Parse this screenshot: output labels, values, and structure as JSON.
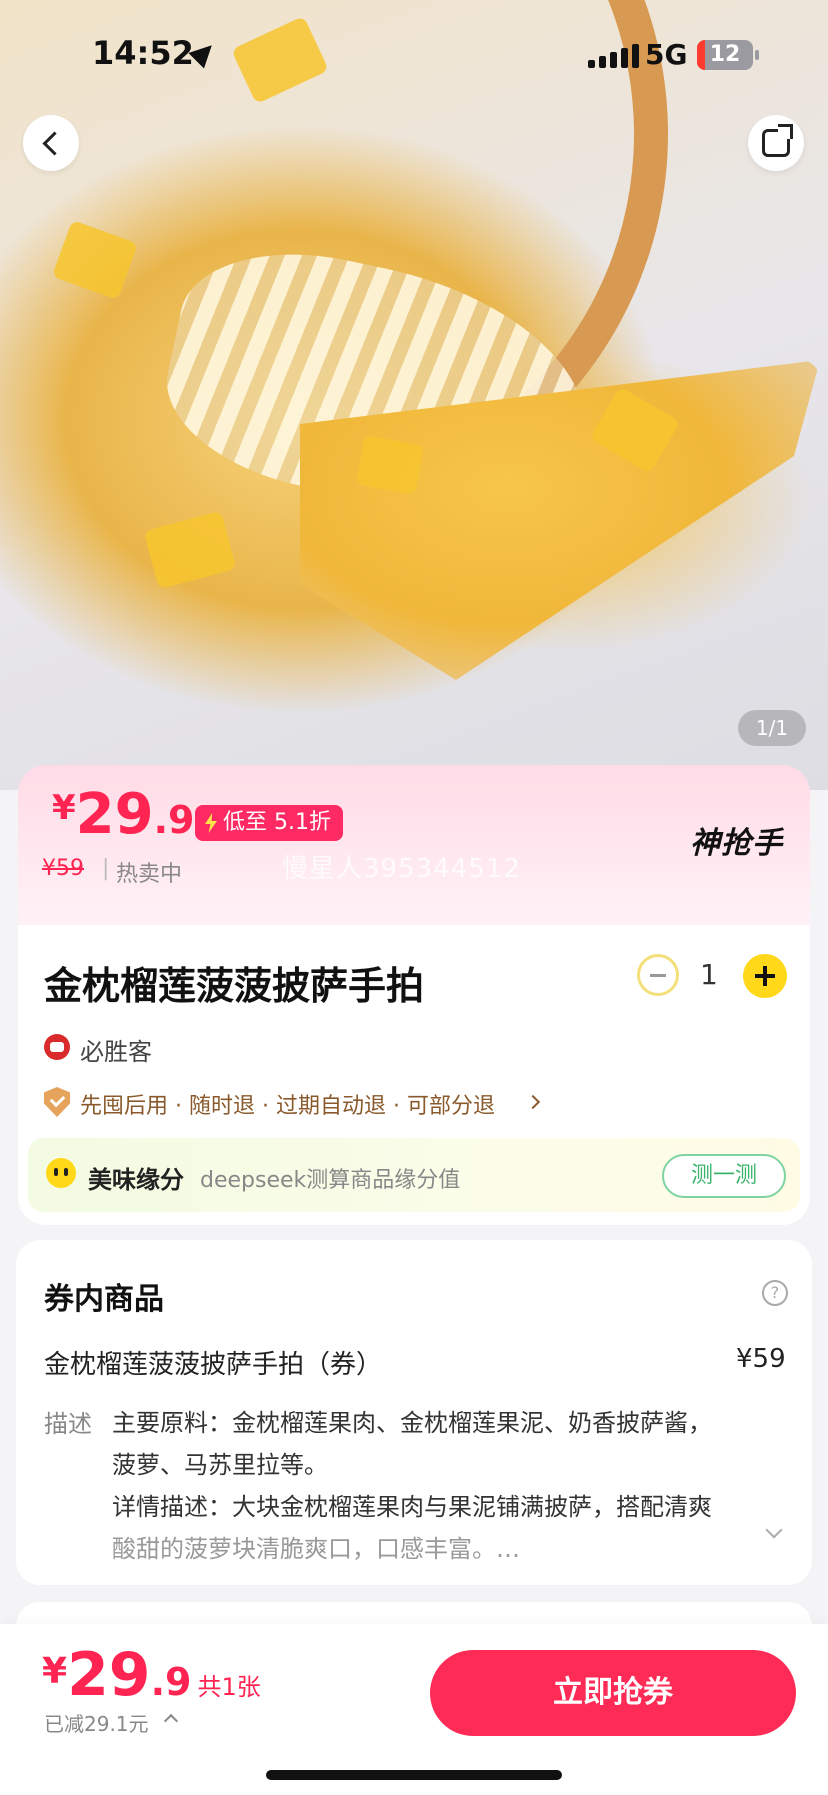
{
  "status_bar": {
    "time": "14:52",
    "network": "5G",
    "battery": "12"
  },
  "hero": {
    "image_counter": "1/1"
  },
  "price": {
    "currency": "¥",
    "integer": "29",
    "decimal": ".9",
    "discount_tag": "低至 5.1折",
    "original_price": "¥59",
    "separator": "|",
    "sales_status": "热卖中",
    "watermark": "慢星人395344512",
    "promo_badge": "神抢手",
    "accent_color": "#ff2451"
  },
  "product": {
    "title": "金枕榴莲菠菠披萨手拍",
    "quantity": "1",
    "brand": "必胜客",
    "guarantees": "先囤后用 · 随时退 · 过期自动退 · 可部分退"
  },
  "fate": {
    "title": "美味缘分",
    "description": "deepseek测算商品缘分值",
    "button_label": "测一测"
  },
  "voucher_items": {
    "heading": "券内商品",
    "help_icon": "?",
    "item_name": "金枕榴莲菠菠披萨手拍（券）",
    "item_price": "¥59",
    "desc_label": "描述",
    "desc_lines": [
      "主要原料：金枕榴莲果肉、金枕榴莲果泥、奶香披萨酱，",
      "菠萝、马苏里拉等。",
      "详情描述：大块金枕榴莲果肉与果泥铺满披萨，搭配清爽",
      "酸甜的菠萝块清脆爽口，口感丰富。…"
    ]
  },
  "bottom_bar": {
    "currency": "¥",
    "integer": "29",
    "decimal": ".9",
    "count": "共1张",
    "saved": "已减29.1元",
    "buy_button": "立即抢券",
    "button_color": "#fe2b56"
  },
  "icons": [
    "back-icon",
    "share-icon",
    "location-arrow-icon",
    "signal-icon",
    "battery-icon",
    "bolt-icon",
    "minus-icon",
    "plus-icon",
    "brand-logo-icon",
    "shield-check-icon",
    "chevron-right-icon",
    "emoji-icon",
    "help-icon",
    "chevron-down-icon",
    "chevron-up-icon"
  ]
}
